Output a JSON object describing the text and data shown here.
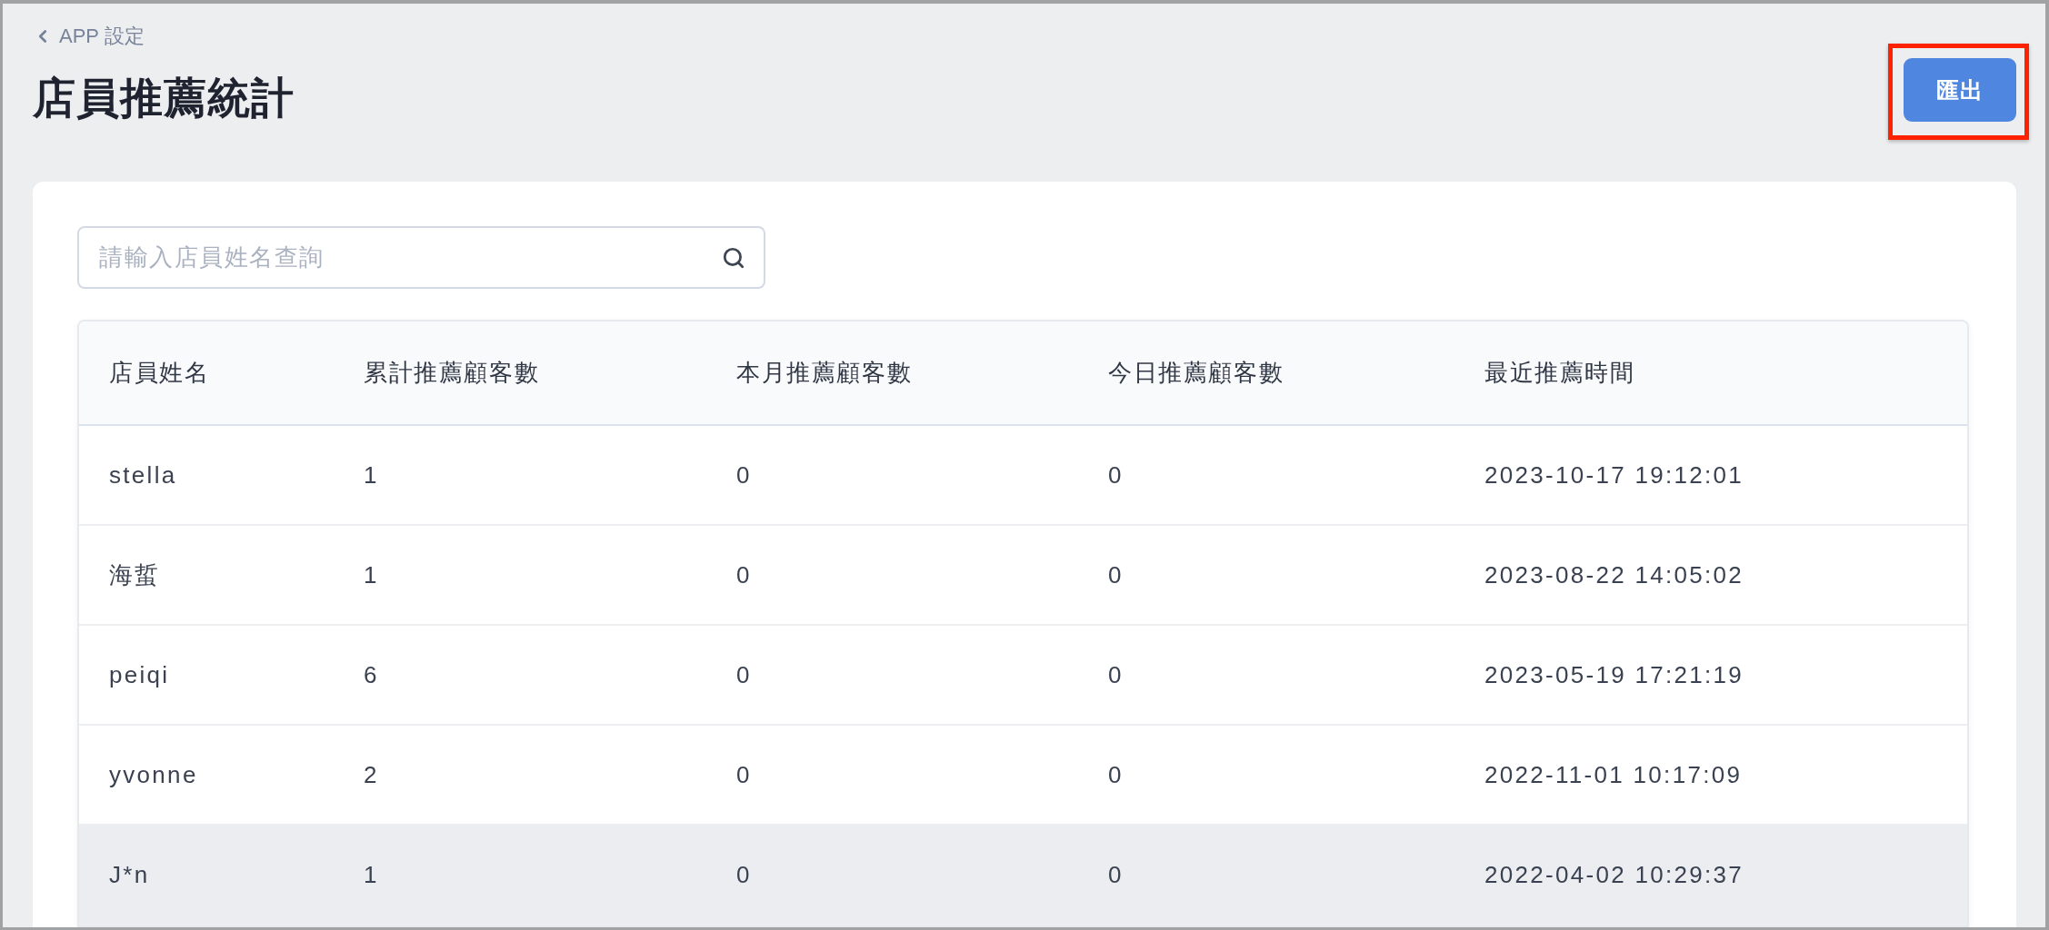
{
  "breadcrumb": {
    "label": "APP 設定"
  },
  "page_title": "店員推薦統計",
  "export_button": {
    "label": "匯出",
    "highlighted": true
  },
  "search": {
    "placeholder": "請輸入店員姓名查詢"
  },
  "table": {
    "columns": [
      "店員姓名",
      "累計推薦顧客數",
      "本月推薦顧客數",
      "今日推薦顧客數",
      "最近推薦時間"
    ],
    "rows": [
      {
        "cells": [
          "stella",
          "1",
          "0",
          "0",
          "2023-10-17 19:12:01"
        ],
        "hovered": false
      },
      {
        "cells": [
          "海蜇",
          "1",
          "0",
          "0",
          "2023-08-22 14:05:02"
        ],
        "hovered": false
      },
      {
        "cells": [
          "peiqi",
          "6",
          "0",
          "0",
          "2023-05-19 17:21:19"
        ],
        "hovered": false
      },
      {
        "cells": [
          "yvonne",
          "2",
          "0",
          "0",
          "2022-11-01 10:17:09"
        ],
        "hovered": false
      },
      {
        "cells": [
          "J*n",
          "1",
          "0",
          "0",
          "2022-04-02 10:29:37"
        ],
        "hovered": true
      }
    ]
  }
}
